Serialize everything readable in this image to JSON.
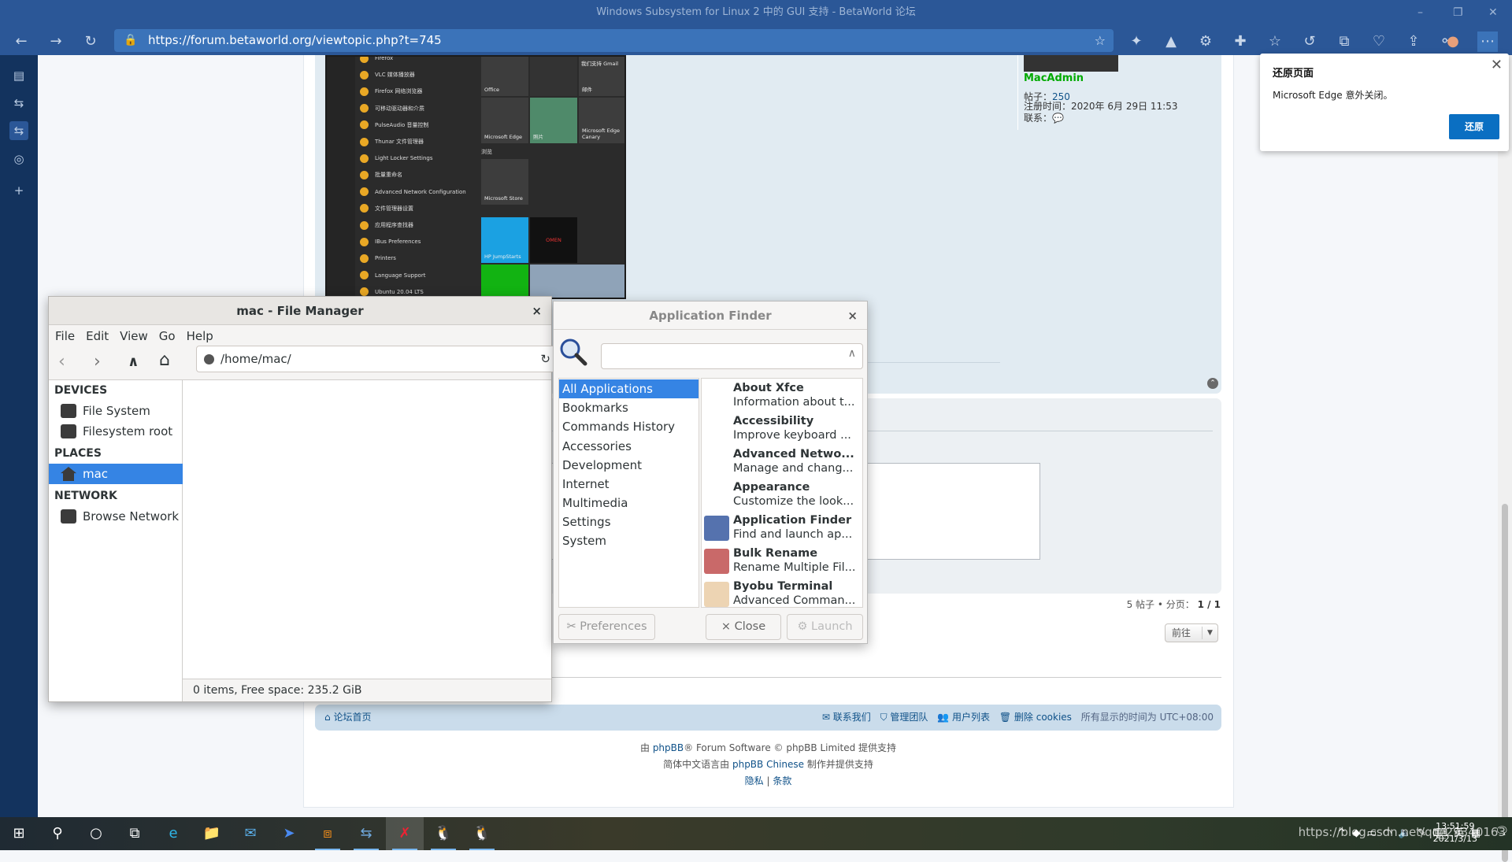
{
  "window": {
    "title": "Windows Subsystem for Linux 2 中的 GUI 支持 - BetaWorld 论坛"
  },
  "browser": {
    "url": "https://forum.betaworld.org/viewtopic.php?t=745",
    "toolbar_icons": [
      "collections-icon",
      "extension-icon",
      "extension-icon-2",
      "extensions-icon",
      "favorites-icon",
      "history-icon",
      "tab-actions-icon",
      "browser-essentials-icon",
      "share-icon",
      "profile-sync-icon",
      "profile-avatar",
      "more-icon"
    ]
  },
  "notification": {
    "title": "还原页面",
    "message": "Microsoft Edge 意外关闭。",
    "button": "还原"
  },
  "post": {
    "start_menu_items": [
      "Firefox",
      "VLC 媒体播放器",
      "Firefox 网络浏览器",
      "可移动驱动器和介质",
      "PulseAudio 音量控制",
      "Thunar 文件管理器",
      "Light Locker Settings",
      "批量重命名",
      "Advanced Network Configuration",
      "文件管理器设置",
      "应用程序查找器",
      "IBus Preferences",
      "Printers",
      "Language Support",
      "Ubuntu 20.04 LTS"
    ],
    "tiles": {
      "office": "Office",
      "mail_promo": "我们支持 Gmail",
      "mail": "邮件",
      "edge": "Microsoft Edge",
      "photos": "照片",
      "edge_canary": "Microsoft Edge Canary",
      "group": "浏览",
      "store": "Microsoft Store",
      "hp": "HP JumpStarts",
      "omen": "OMEN"
    },
    "author": {
      "name": "MacAdmin",
      "posts_label": "帖子：",
      "posts": "250",
      "joined_label": "注册时间：",
      "joined": "2020年 6月 29日 11:53",
      "contact_label": "联系："
    }
  },
  "pagination": {
    "count": "5 帖子 • 分页：",
    "page": "1 / 1",
    "jump": "前往"
  },
  "footer": {
    "home": "论坛首页",
    "links": [
      "联系我们",
      "管理团队",
      "用户列表",
      "删除 cookies"
    ],
    "timezone": "所有显示的时间为 UTC+08:00",
    "line1_pre": "由 ",
    "line1_link": "phpBB",
    "line1_post": "® Forum Software © phpBB Limited 提供支持",
    "line2_pre": "简体中文语言由 ",
    "line2_link": "phpBB Chinese",
    "line2_post": " 制作并提供支持",
    "privacy": "隐私",
    "sep": " | ",
    "terms": "条款"
  },
  "file_manager": {
    "title": "mac - File Manager",
    "menu": [
      "File",
      "Edit",
      "View",
      "Go",
      "Help"
    ],
    "path": "/home/mac/",
    "sections": {
      "devices": "DEVICES",
      "places": "PLACES",
      "network": "NETWORK"
    },
    "devices": [
      "File System",
      "Filesystem root"
    ],
    "places": [
      "mac"
    ],
    "network": [
      "Browse Network"
    ],
    "status": "0 items, Free space: 235.2 GiB"
  },
  "app_finder": {
    "title": "Application Finder",
    "search_value": "",
    "categories": [
      "All Applications",
      "Bookmarks",
      "Commands History",
      "Accessories",
      "Development",
      "Internet",
      "Multimedia",
      "Settings",
      "System"
    ],
    "selected_category": "All Applications",
    "apps": [
      {
        "name": "About Xfce",
        "desc": "Information about t..."
      },
      {
        "name": "Accessibility",
        "desc": "Improve keyboard ..."
      },
      {
        "name": "Advanced Netwo...",
        "desc": "Manage and chang..."
      },
      {
        "name": "Appearance",
        "desc": "Customize the look..."
      },
      {
        "name": "Application Finder",
        "desc": "Find and launch ap..."
      },
      {
        "name": "Bulk Rename",
        "desc": "Rename Multiple Fil..."
      },
      {
        "name": "Byobu Terminal",
        "desc": "Advanced Comman..."
      }
    ],
    "buttons": {
      "preferences": "Preferences",
      "close": "Close",
      "launch": "Launch"
    }
  },
  "taskbar": {
    "apps": [
      "start",
      "search",
      "cortana",
      "task-view",
      "edge-canary",
      "file-explorer",
      "mail",
      "feedback",
      "remote-desktop",
      "wsl-app",
      "xfce-app",
      "linux-app-1",
      "linux-app-2"
    ],
    "time": "13:51:59",
    "date": "2021/3/13",
    "ime": "英"
  },
  "watermark": "https://blog.csdn.net/qq_29340163",
  "colors": {
    "chrome": "#2b5797",
    "accent": "#3584e4",
    "forum_post": "#e1ebf2",
    "username": "#00aa00",
    "link": "#105289"
  }
}
